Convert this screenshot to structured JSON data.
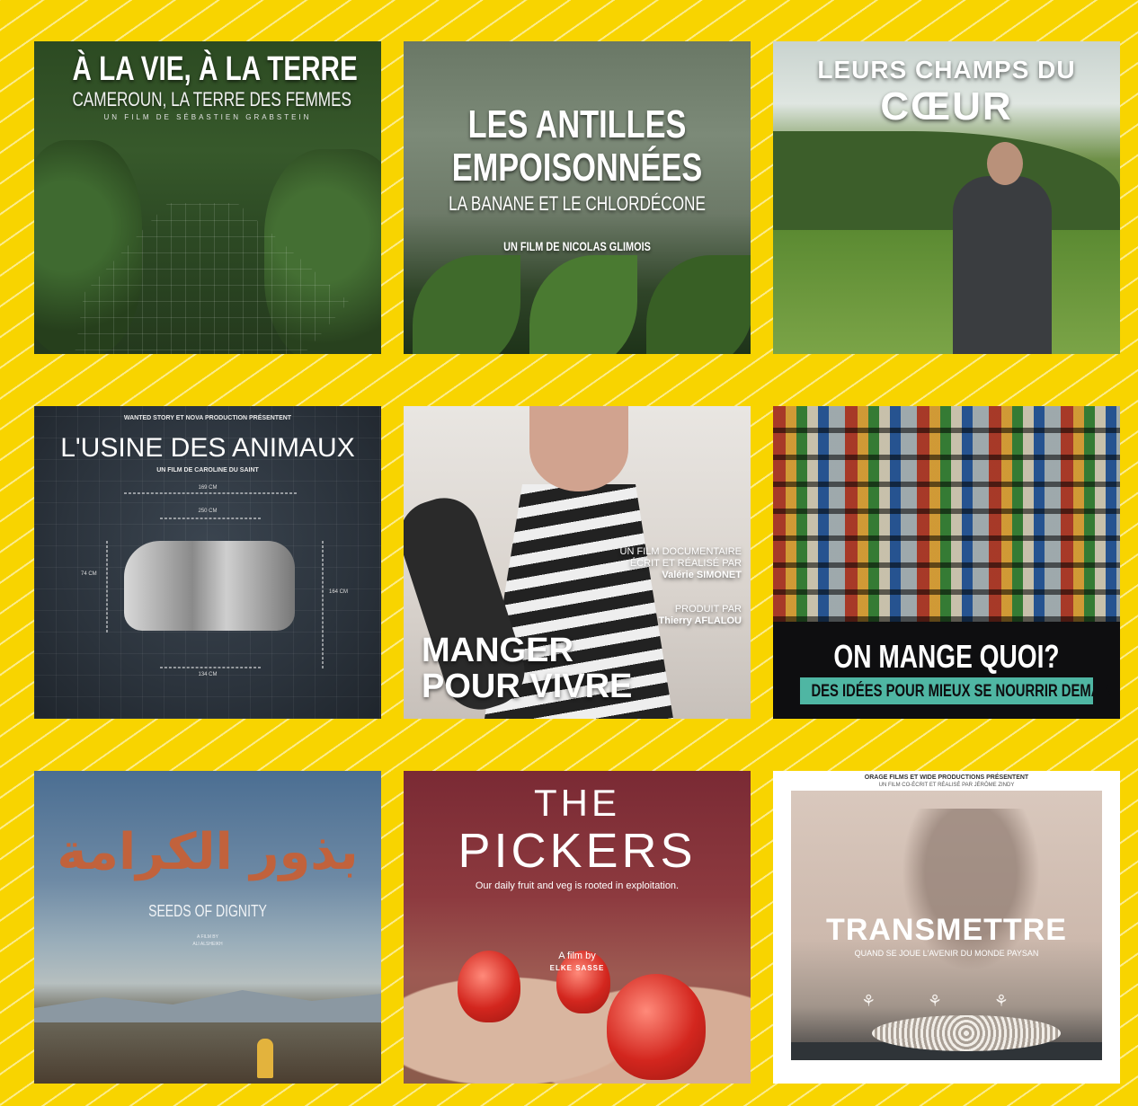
{
  "posters": [
    {
      "title": "À LA VIE, À LA TERRE",
      "subtitle": "CAMEROUN, LA TERRE DES FEMMES",
      "credit": "UN FILM DE SÉBASTIEN GRABSTEIN"
    },
    {
      "title_line1": "LES ANTILLES",
      "title_line2": "EMPOISONNÉES",
      "subtitle": "LA BANANE ET LE CHLORDÉCONE",
      "credit": "UN FILM DE NICOLAS GLIMOIS"
    },
    {
      "title_line1": "LEURS CHAMPS DU",
      "title_line2": "CŒUR"
    },
    {
      "tagline": "WANTED STORY ET NOVA PRODUCTION PRÉSENTENT",
      "title": "L'USINE DES ANIMAUX",
      "credit": "UN FILM DE CAROLINE DU SAINT",
      "dim_top": "169 CM",
      "dim_mid": "250 CM",
      "dim_left": "74 CM",
      "dim_right": "164 CM",
      "dim_bottom": "134 CM"
    },
    {
      "credit_line1": "UN FILM DOCUMENTAIRE",
      "credit_line2": "ÉCRIT ET RÉALISÉ PAR",
      "director": "Valérie SIMONET",
      "producer_label": "PRODUIT PAR",
      "producer": "Thierry AFLALOU",
      "title_line1": "MANGER",
      "title_line2": "POUR VIVRE"
    },
    {
      "title": "ON MANGE QUOI?",
      "subtitle": "DES IDÉES POUR MIEUX SE NOURRIR DEMAIN"
    },
    {
      "arabic_title": "بذور الكرامة",
      "title": "SEEDS OF DIGNITY",
      "film_by": "A FILM BY",
      "director": "ALI ALSHEIKH"
    },
    {
      "title_line1": "THE",
      "title_line2": "PICKERS",
      "tagline": "Our daily fruit and veg is rooted in exploitation.",
      "film_by": "A film by",
      "director": "ELKE SASSE"
    },
    {
      "presenters": "ORAGE FILMS ET WIDE PRODUCTIONS PRÉSENTENT",
      "credit": "UN FILM CO-ÉCRIT ET RÉALISÉ PAR JÉRÔME ZINDY",
      "title": "TRANSMETTRE",
      "subtitle": "QUAND SE JOUE L'AVENIR DU MONDE PAYSAN",
      "laurels": "⚘ ⚘ ⚘"
    }
  ]
}
